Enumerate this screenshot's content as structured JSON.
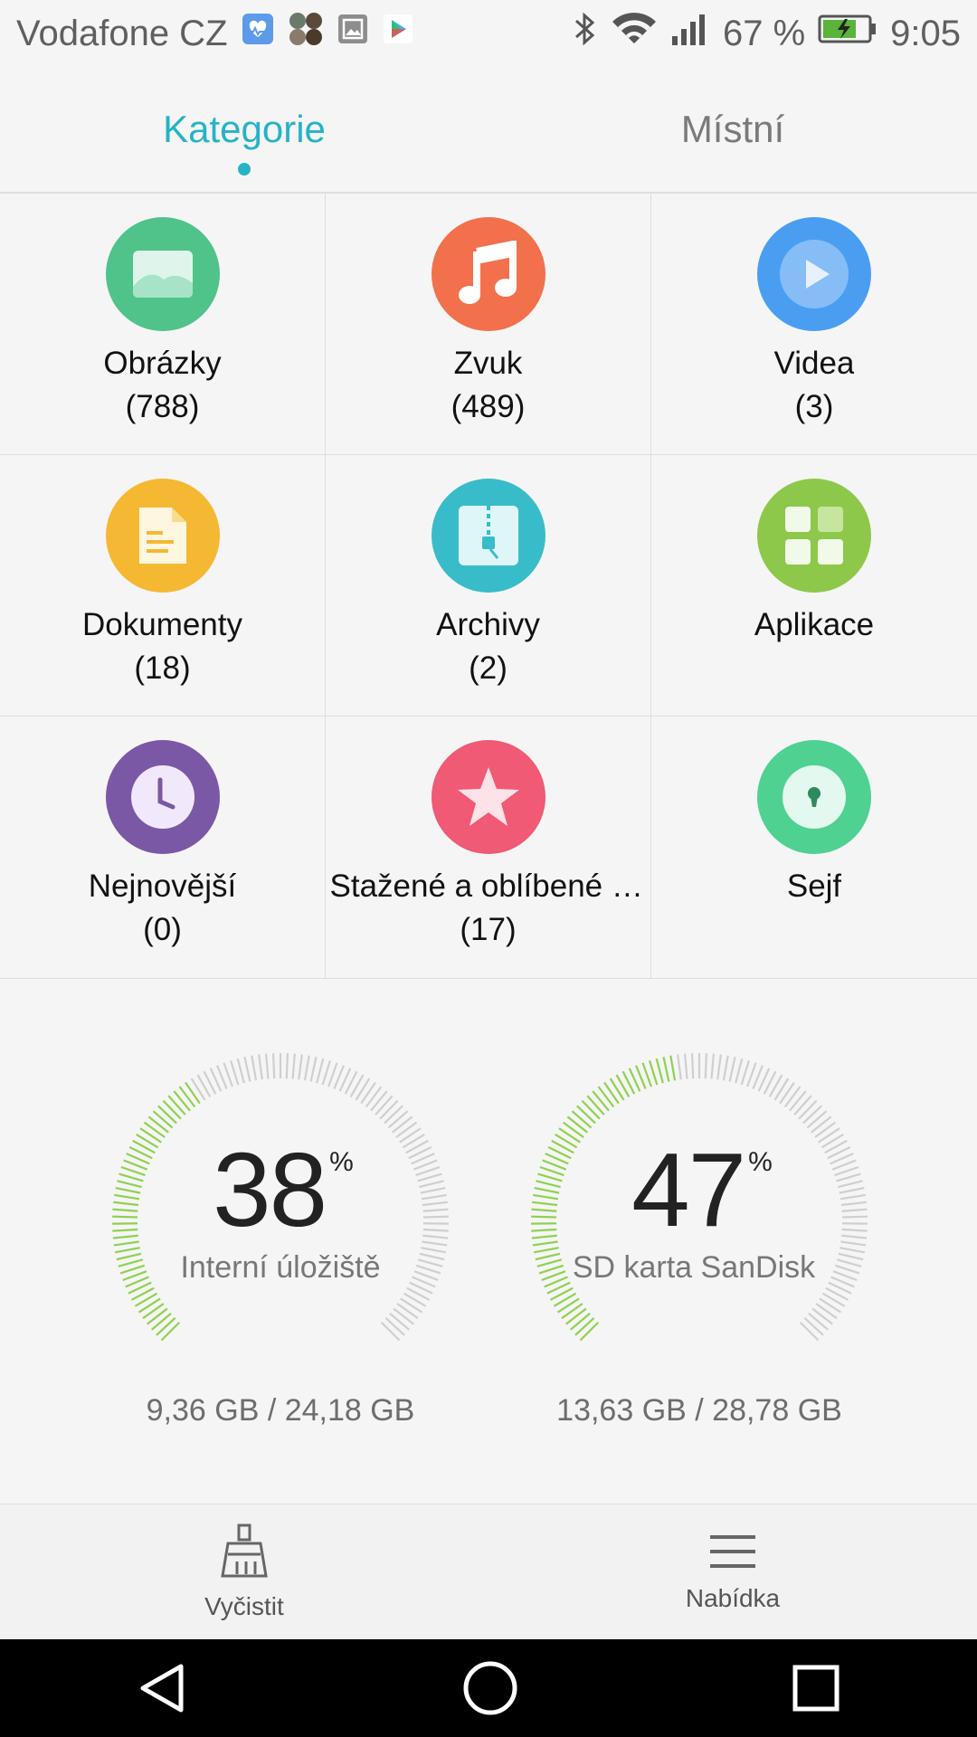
{
  "status_bar": {
    "carrier": "Vodafone CZ",
    "battery_percent": "67 %",
    "time": "9:05",
    "icons": [
      "health-app-icon",
      "contacts-icon",
      "gallery-icon",
      "play-store-icon",
      "bluetooth-icon",
      "wifi-icon",
      "signal-icon",
      "battery-charging-icon"
    ]
  },
  "tabs": [
    {
      "label": "Kategorie",
      "active": true
    },
    {
      "label": "Místní",
      "active": false
    }
  ],
  "categories": [
    {
      "label": "Obrázky",
      "count": "(788)",
      "icon": "image-icon",
      "color": "#4fc38a"
    },
    {
      "label": "Zvuk",
      "count": "(489)",
      "icon": "music-note-icon",
      "color": "#f2704b"
    },
    {
      "label": "Videa",
      "count": "(3)",
      "icon": "play-icon",
      "color": "#4a9ef2"
    },
    {
      "label": "Dokumenty",
      "count": "(18)",
      "icon": "document-icon",
      "color": "#f5b833"
    },
    {
      "label": "Archivy",
      "count": "(2)",
      "icon": "zip-archive-icon",
      "color": "#39bcc9"
    },
    {
      "label": "Aplikace",
      "count": "",
      "icon": "apps-grid-icon",
      "color": "#8dc84a"
    },
    {
      "label": "Nejnovější",
      "count": "(0)",
      "icon": "clock-icon",
      "color": "#7b58a6"
    },
    {
      "label": "Stažené a oblíbené s...",
      "count": "(17)",
      "icon": "star-icon",
      "color": "#f05a74"
    },
    {
      "label": "Sejf",
      "count": "",
      "icon": "safe-lock-icon",
      "color": "#4fd192"
    }
  ],
  "storage": [
    {
      "percent": "38",
      "percent_value": 38,
      "sign": "%",
      "name": "Interní úložiště",
      "size": "9,36 GB / 24,18 GB"
    },
    {
      "percent": "47",
      "percent_value": 47,
      "sign": "%",
      "name": "SD karta SanDisk",
      "size": "13,63 GB / 28,78 GB"
    }
  ],
  "toolbar": [
    {
      "label": "Vyčistit",
      "icon": "broom-icon"
    },
    {
      "label": "Nabídka",
      "icon": "menu-icon"
    }
  ],
  "nav": [
    "back-icon",
    "home-icon",
    "recents-icon"
  ],
  "colors": {
    "accent": "#26b3c6",
    "gauge_fill": "#8fd14f",
    "gauge_track": "#cfcfcf"
  }
}
